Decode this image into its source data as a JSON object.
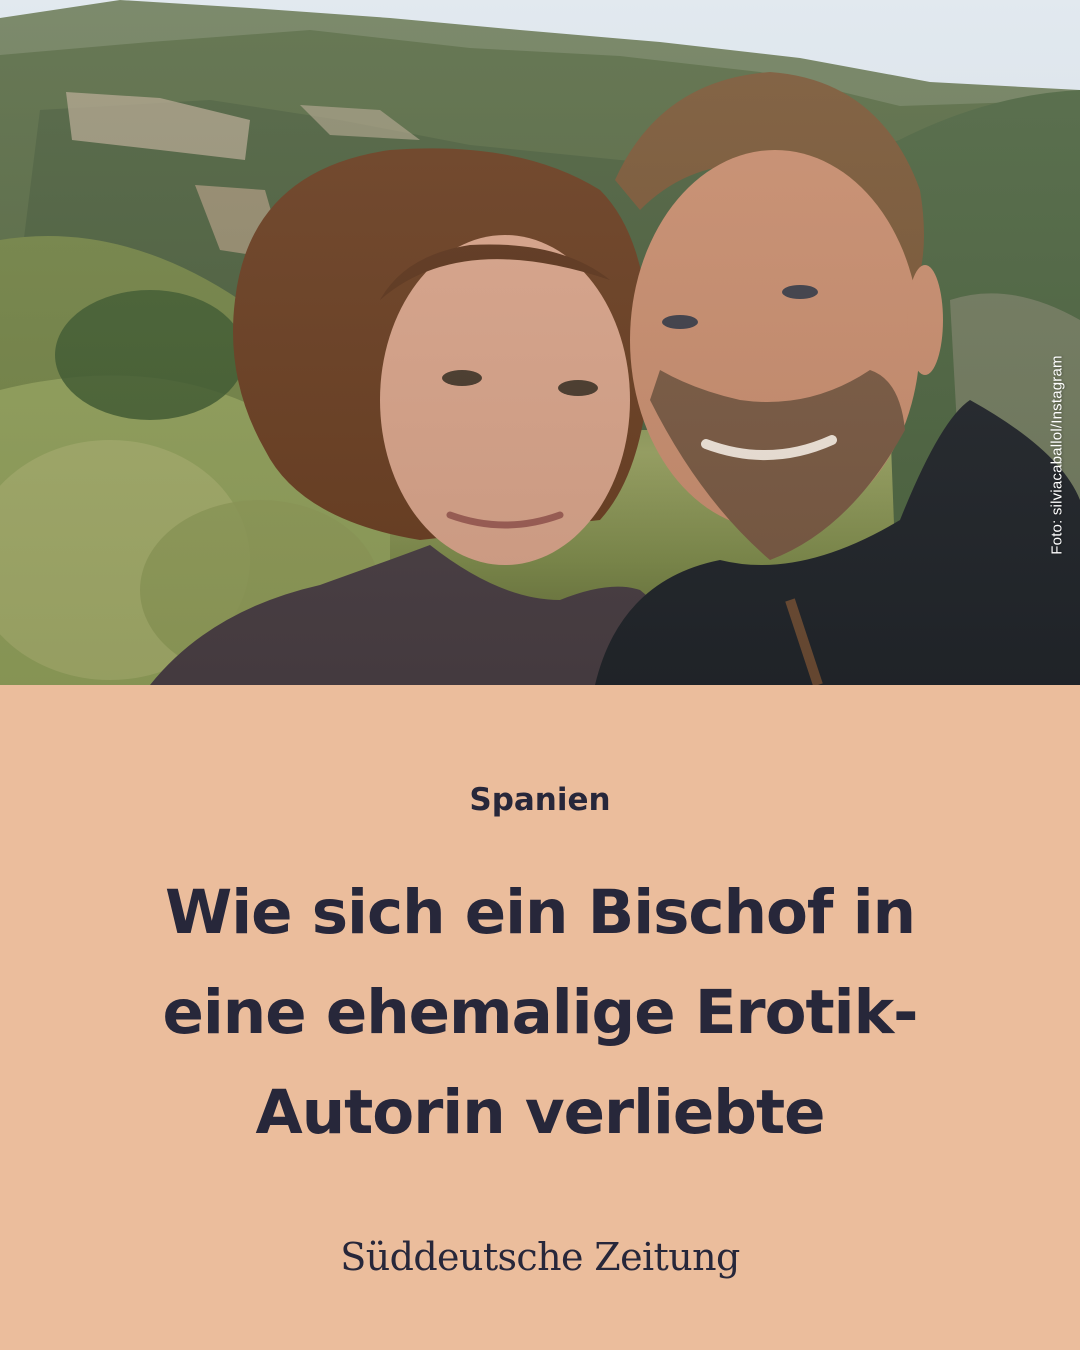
{
  "photo": {
    "credit": "Foto: silviacaballol/Instagram",
    "subject": "selfie-couple-mountains-photo"
  },
  "article": {
    "kicker": "Spanien",
    "headline_lines": [
      "Wie sich ein Bischof in",
      "eine ehemalige Erotik-",
      "Autorin verliebte"
    ]
  },
  "brand": {
    "name": "Süddeutsche Zeitung"
  },
  "colors": {
    "panel_background": "#ebbd9c",
    "text": "#27273a"
  }
}
